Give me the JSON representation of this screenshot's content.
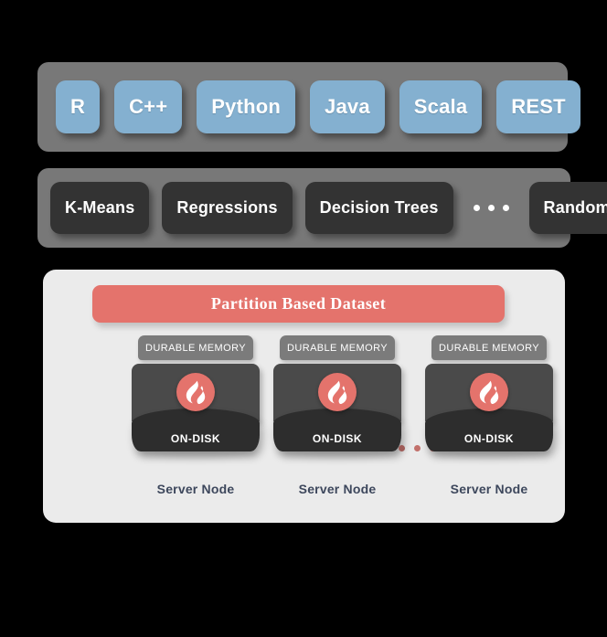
{
  "diagram": {
    "background_color": "#000000",
    "api_panel": {
      "panel_color": "#787878",
      "chip_color": "#84b0d0",
      "items": [
        {
          "label": "R"
        },
        {
          "label": "C++"
        },
        {
          "label": "Python"
        },
        {
          "label": "Java"
        },
        {
          "label": "Scala"
        },
        {
          "label": "REST"
        }
      ]
    },
    "algorithms_panel": {
      "panel_color": "#787878",
      "chip_color": "#333333",
      "items": [
        {
          "label": "K-Means"
        },
        {
          "label": "Regressions"
        },
        {
          "label": "Decision Trees"
        }
      ],
      "ellipsis": "• • •",
      "trailing_items": [
        {
          "label": "Random Forest"
        }
      ]
    },
    "cluster_panel": {
      "panel_color": "#ebebeb",
      "dataset_banner": {
        "label": "Partition Based Dataset",
        "color": "#e4736c"
      },
      "node_ellipsis": "• • •",
      "nodes": [
        {
          "memory_label": "DURABLE MEMORY",
          "disk_label": "ON-DISK",
          "logo": "ignite-flame-icon",
          "node_label": "Server Node"
        },
        {
          "memory_label": "DURABLE MEMORY",
          "disk_label": "ON-DISK",
          "logo": "ignite-flame-icon",
          "node_label": "Server Node"
        },
        {
          "memory_label": "DURABLE MEMORY",
          "disk_label": "ON-DISK",
          "logo": "ignite-flame-icon",
          "node_label": "Server Node"
        }
      ]
    }
  }
}
